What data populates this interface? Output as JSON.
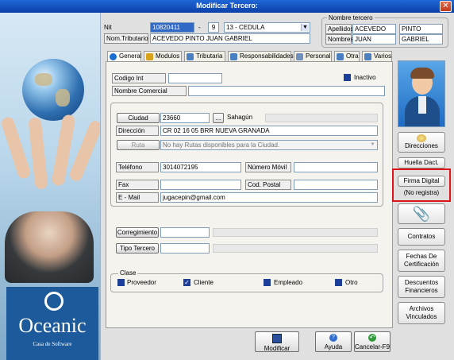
{
  "window": {
    "title": "Modificar Tercero:",
    "close_icon": "close-icon"
  },
  "brand": {
    "name": "Oceanic",
    "sub": "Casa de Software"
  },
  "header": {
    "nit_label": "Nit",
    "nit_value": "10820411",
    "dv_value": "9",
    "doc_type": "13 - CEDULA",
    "nom_trib_label": "Nom.Tributario",
    "nom_trib_value": "ACEVEDO PINTO JUAN GABRIEL"
  },
  "nombre_tercero": {
    "legend": "Nombre tercero",
    "apellidos_label": "Apellidos",
    "apellido1": "ACEVEDO",
    "apellido2": "PINTO",
    "nombres_label": "Nombres",
    "nombre1": "JUAN",
    "nombre2": "GABRIEL"
  },
  "tabs": [
    "General",
    "Modulos",
    "Tributaria",
    "Responsabilidades",
    "Personal",
    "Otra",
    "Varios"
  ],
  "general": {
    "codigo_int_label": "Codigo Int",
    "codigo_int_value": "",
    "inactivo_label": "Inactivo",
    "nombre_comercial_label": "Nombre Comercial",
    "nombre_comercial_value": "",
    "ciudad_label": "Ciudad",
    "ciudad_value": "23660",
    "ciudad_browse": "...",
    "ciudad_name": "Sahagún",
    "direccion_label": "Dirección",
    "direccion_value": "CR 02 16 05 BRR NUEVA GRANADA",
    "ruta_label": "Ruta",
    "ruta_value": "No hay Rutas disponibles para la Ciudad.",
    "telefono_label": "Teléfono",
    "telefono_value": "3014072195",
    "movil_label": "Número Móvil",
    "movil_value": "",
    "fax_label": "Fax",
    "fax_value": "",
    "postal_label": "Cod. Postal",
    "postal_value": "",
    "email_label": "E - Mail",
    "email_value": "jugacepin@gmail.com",
    "corregimiento_label": "Corregimiento",
    "tipo_tercero_label": "Tipo Tercero",
    "clase_legend": "Clase",
    "clase_options": [
      "Proveedor",
      "Cliente",
      "Empleado",
      "Otro"
    ]
  },
  "side_buttons": {
    "direcciones": "Direcciones",
    "huella": "Huella Dact.",
    "firma": "Firma Digital",
    "firma_status": "(No registra)",
    "contratos": "Contratos",
    "fechas_1": "Fechas De",
    "fechas_2": "Certificación",
    "descuentos_1": "Descuentos",
    "descuentos_2": "Financieros",
    "archivos_1": "Archivos",
    "archivos_2": "Vinculados"
  },
  "footer": {
    "modificar": "Modificar",
    "ayuda": "Ayuda",
    "cancelar": "Cancelar-F9"
  },
  "colors": {
    "titlebar": "#0b3fa8",
    "highlight": "#e0151b",
    "selected_field": "#3169c6"
  }
}
